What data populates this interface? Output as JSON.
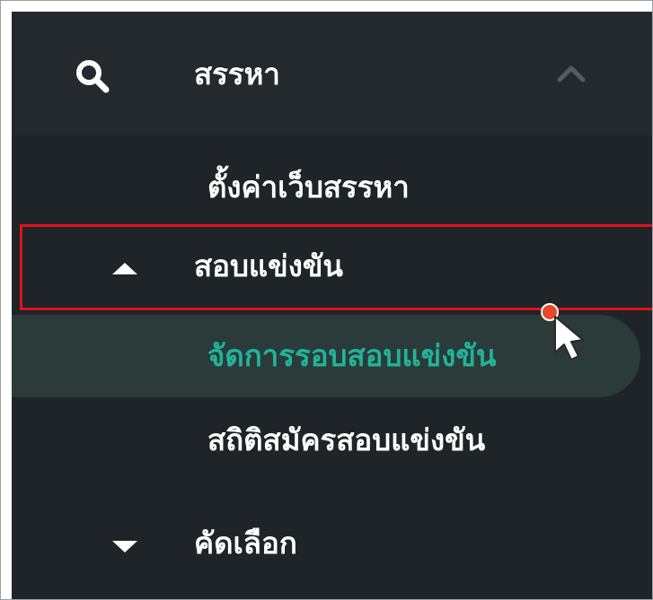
{
  "menu": {
    "search_section": {
      "label": "สรรหา",
      "icon": "search-icon",
      "toggle_icon": "chevron-up-icon"
    },
    "items": [
      {
        "label": "ตั้งค่าเว็บสรรหา"
      },
      {
        "label": "สอบแข่งขัน",
        "icon": "caret-up-icon"
      },
      {
        "label": "จัดการรอบสอบแข่งขัน",
        "active": true
      },
      {
        "label": "สถิติสมัครสอบแข่งขัน"
      },
      {
        "label": "คัดเลือก",
        "icon": "caret-down-icon"
      }
    ]
  },
  "colors": {
    "sidebar_bg": "#1f2428",
    "header_bg": "#23292d",
    "active_text": "#22b39a",
    "active_pill": "#2a3b3a",
    "highlight_border": "#e0121b",
    "cursor_dot": "#e8482a"
  },
  "annotations": {
    "highlight_box": "red-rectangle",
    "cursor": "mouse-pointer-icon"
  }
}
